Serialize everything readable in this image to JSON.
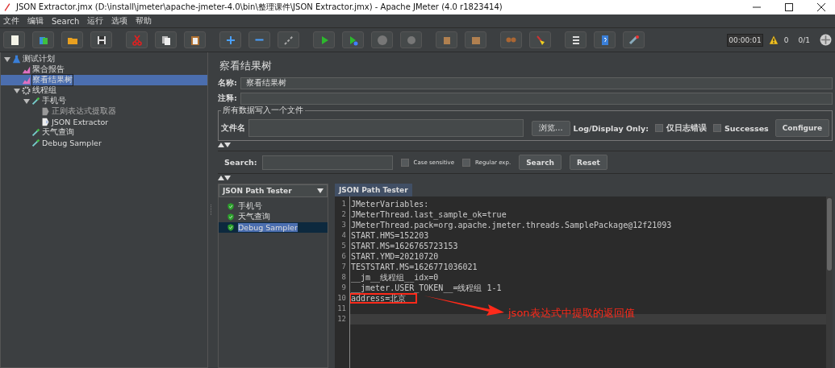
{
  "window": {
    "title": "JSON Extractor.jmx (D:\\install\\jmeter\\apache-jmeter-4.0\\bin\\整理课件\\JSON Extractor.jmx) - Apache JMeter (4.0 r1823414)"
  },
  "menu": [
    "文件",
    "编辑",
    "Search",
    "运行",
    "选项",
    "帮助"
  ],
  "status": {
    "timer": "00:00:01",
    "warnings": "0",
    "threads": "0/1"
  },
  "tree": [
    {
      "label": "测试计划",
      "kind": "plan",
      "selected": false,
      "expanded": true,
      "children": [
        {
          "label": "聚合报告",
          "kind": "listener",
          "selected": false
        },
        {
          "label": "察看结果树",
          "kind": "listener",
          "selected": true
        },
        {
          "label": "线程组",
          "kind": "thread-group",
          "selected": false,
          "expanded": true,
          "children": [
            {
              "label": "手机号",
              "kind": "sampler",
              "selected": false,
              "expanded": true,
              "children": [
                {
                  "label": "正则表达式提取器",
                  "kind": "regex-extractor",
                  "selected": false
                },
                {
                  "label": "JSON Extractor",
                  "kind": "json-extractor",
                  "selected": false
                }
              ]
            },
            {
              "label": "天气查询",
              "kind": "sampler",
              "selected": false
            },
            {
              "label": "Debug Sampler",
              "kind": "sampler",
              "selected": false
            }
          ]
        }
      ]
    }
  ],
  "panel": {
    "title": "察看结果树",
    "name_label": "名称:",
    "name_value": "察看结果树",
    "comment_label": "注释:",
    "file_group": {
      "legend": "所有数据写入一个文件",
      "file_label": "文件名",
      "browse": "浏览...",
      "log_label": "Log/Display Only:",
      "options": [
        {
          "label": "仅日志错误",
          "checked": false
        },
        {
          "label": "Successes",
          "checked": false
        }
      ],
      "configure": "Configure"
    },
    "search": {
      "label": "Search:",
      "options": [
        {
          "label": "Case sensitive",
          "checked": false
        },
        {
          "label": "Regular exp.",
          "checked": false
        }
      ],
      "buttons": [
        "Search",
        "Reset"
      ]
    }
  },
  "results": {
    "renderer": "JSON Path Tester",
    "samples": [
      {
        "label": "手机号",
        "selected": false
      },
      {
        "label": "天气查询",
        "selected": false
      },
      {
        "label": "Debug Sampler",
        "selected": true
      }
    ],
    "tab": {
      "label": "JSON Path Tester",
      "selected": true
    },
    "lines": [
      {
        "number": "1",
        "text": "JMeterVariables:",
        "boxed": false,
        "current": false
      },
      {
        "number": "2",
        "text": "JMeterThread.last_sample_ok=true",
        "boxed": false,
        "current": false
      },
      {
        "number": "3",
        "text": "JMeterThread.pack=org.apache.jmeter.threads.SamplePackage@12f21093",
        "boxed": false,
        "current": false
      },
      {
        "number": "4",
        "text": "START.HMS=152203",
        "boxed": false,
        "current": false
      },
      {
        "number": "5",
        "text": "START.MS=1626765723153",
        "boxed": false,
        "current": false
      },
      {
        "number": "6",
        "text": "START.YMD=20210720",
        "boxed": false,
        "current": false
      },
      {
        "number": "7",
        "text": "TESTSTART.MS=1626771036021",
        "boxed": false,
        "current": false
      },
      {
        "number": "8",
        "text": "__jm__线程组__idx=0",
        "boxed": false,
        "current": false
      },
      {
        "number": "9",
        "text": "__jmeter.USER_TOKEN__=线程组 1-1",
        "boxed": false,
        "current": false
      },
      {
        "number": "10",
        "text": "address=北京",
        "boxed": true,
        "current": false
      },
      {
        "number": "11"
      },
      {
        "number": "12",
        "current": true
      }
    ],
    "annotation": {
      "text": "json表达式中提取的返回值",
      "color": "#ff2a1a"
    }
  }
}
